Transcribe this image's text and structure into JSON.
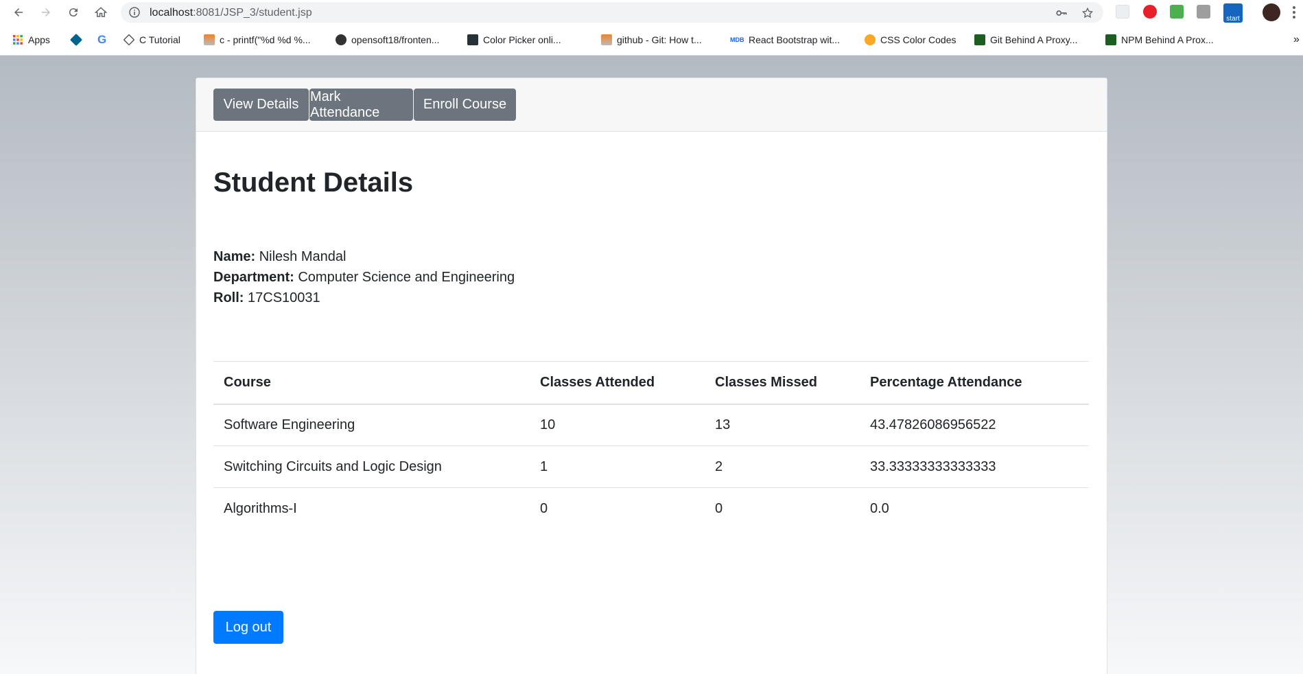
{
  "browser": {
    "url_host": "localhost",
    "url_rest": ":8081/JSP_3/student.jsp",
    "bookmarks": [
      {
        "label": "Apps",
        "icon": "apps-grid-icon"
      },
      {
        "label": "",
        "icon": "dominos-icon"
      },
      {
        "label": "",
        "icon": "google-icon"
      },
      {
        "label": "C Tutorial",
        "icon": "c-tutorial-icon"
      },
      {
        "label": "c - printf(\"%d %d %...",
        "icon": "stackoverflow-icon"
      },
      {
        "label": "opensoft18/fronten...",
        "icon": "github-icon"
      },
      {
        "label": "Color Picker onli...",
        "icon": "color-picker-icon"
      },
      {
        "label": "github - Git: How t...",
        "icon": "stackoverflow-icon"
      },
      {
        "label": "React Bootstrap wit...",
        "icon": "mdb-icon"
      },
      {
        "label": "CSS Color Codes",
        "icon": "css-color-icon"
      },
      {
        "label": "Git Behind A Proxy...",
        "icon": "terminal-icon"
      },
      {
        "label": "NPM Behind A Prox...",
        "icon": "terminal-icon"
      }
    ],
    "overflow": "»",
    "ext_badge": "start"
  },
  "nav": {
    "view_details": "View Details",
    "mark_attendance": "Mark Attendance",
    "enroll_course": "Enroll Course"
  },
  "student": {
    "heading": "Student Details",
    "name_label": "Name:",
    "name": "Nilesh Mandal",
    "department_label": "Department:",
    "department": "Computer Science and Engineering",
    "roll_label": "Roll:",
    "roll": "17CS10031"
  },
  "table": {
    "headers": [
      "Course",
      "Classes Attended",
      "Classes Missed",
      "Percentage Attendance"
    ],
    "rows": [
      [
        "Software Engineering",
        "10",
        "13",
        "43.47826086956522"
      ],
      [
        "Switching Circuits and Logic Design",
        "1",
        "2",
        "33.33333333333333"
      ],
      [
        "Algorithms-I",
        "0",
        "0",
        "0.0"
      ]
    ]
  },
  "logout_label": "Log out",
  "colors": {
    "secondary": "#6c757d",
    "primary": "#007bff"
  }
}
